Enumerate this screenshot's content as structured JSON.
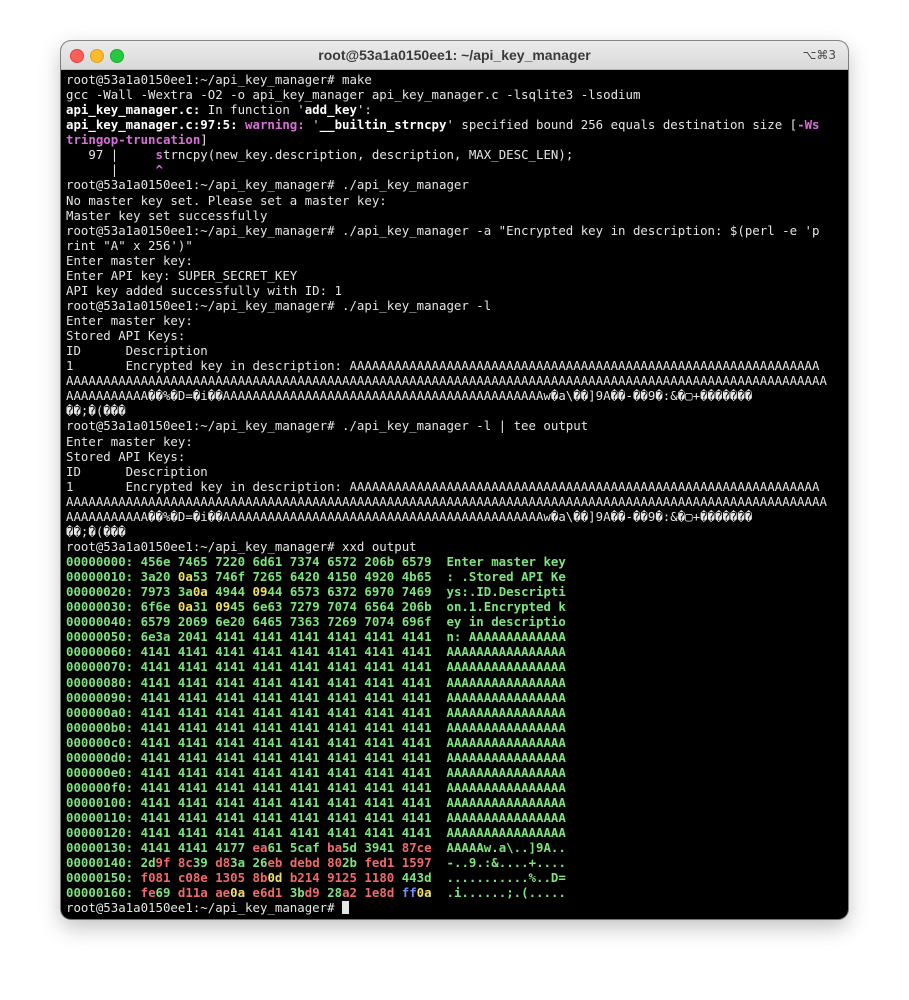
{
  "window": {
    "title": "root@53a1a0150ee1: ~/api_key_manager",
    "shortcut": "⌥⌘3"
  },
  "colors": {
    "green": "#7ee37e",
    "yellow": "#f0e060",
    "red": "#ef6a6a",
    "blue": "#6c8ef5",
    "magenta": "#d670d6"
  },
  "terminal": {
    "prompt": "root@53a1a0150ee1:~/api_key_manager# ",
    "lines": [
      [
        {
          "t": "root@53a1a0150ee1:~/api_key_manager# make"
        }
      ],
      [
        {
          "t": "gcc -Wall -Wextra -O2 -o api_key_manager api_key_manager.c -lsqlite3 -lsodium"
        }
      ],
      [
        {
          "t": "api_key_manager.c:",
          "c": "bold"
        },
        {
          "t": " In function '"
        },
        {
          "t": "add_key",
          "c": "bold"
        },
        {
          "t": "':"
        }
      ],
      [
        {
          "t": "api_key_manager.c:97:5: ",
          "c": "bold"
        },
        {
          "t": "warning: ",
          "c": "mag"
        },
        {
          "t": "'"
        },
        {
          "t": "__builtin_strncpy",
          "c": "bold"
        },
        {
          "t": "' specified bound 256 equals destination size ["
        },
        {
          "t": "-Ws",
          "c": "mag"
        }
      ],
      [
        {
          "t": "tringop-truncation",
          "c": "mag"
        },
        {
          "t": "]"
        }
      ],
      [
        {
          "t": "   97 |     "
        },
        {
          "t": "s",
          "c": "mag"
        },
        {
          "t": "trncpy(new_key.description, description, MAX_DESC_LEN);"
        }
      ],
      [
        {
          "t": "      |     "
        },
        {
          "t": "^",
          "c": "mag"
        }
      ],
      [
        {
          "t": "root@53a1a0150ee1:~/api_key_manager# ./api_key_manager"
        }
      ],
      [
        {
          "t": "No master key set. Please set a master key:"
        }
      ],
      [
        {
          "t": "Master key set successfully"
        }
      ],
      [
        {
          "t": "root@53a1a0150ee1:~/api_key_manager# ./api_key_manager -a \"Encrypted key in description: $(perl -e 'p"
        }
      ],
      [
        {
          "t": "rint \"A\" x 256')\""
        }
      ],
      [
        {
          "t": "Enter master key:"
        }
      ],
      [
        {
          "t": "Enter API key: SUPER_SECRET_KEY"
        }
      ],
      [
        {
          "t": "API key added successfully with ID: 1"
        }
      ],
      [
        {
          "t": "root@53a1a0150ee1:~/api_key_manager# ./api_key_manager -l"
        }
      ],
      [
        {
          "t": "Enter master key:"
        }
      ],
      [
        {
          "t": "Stored API Keys:"
        }
      ],
      [
        {
          "t": "ID      Description"
        }
      ],
      [
        {
          "t": "1       Encrypted key in description: AAAAAAAAAAAAAAAAAAAAAAAAAAAAAAAAAAAAAAAAAAAAAAAAAAAAAAAAAAAAAAA"
        }
      ],
      [
        {
          "t": "AAAAAAAAAAAAAAAAAAAAAAAAAAAAAAAAAAAAAAAAAAAAAAAAAAAAAAAAAAAAAAAAAAAAAAAAAAAAAAAAAAAAAAAAAAAAAAAAAAAAAA"
        }
      ],
      [
        {
          "t": "AAAAAAAAAAA��%�D=�i��AAAAAAAAAAAAAAAAAAAAAAAAAAAAAAAAAAAAAAAAAAAw�a\\��]9A��-��9�:&�▢+�������"
        }
      ],
      [
        {
          "t": "��;�(���"
        }
      ],
      [
        {
          "t": "root@53a1a0150ee1:~/api_key_manager# ./api_key_manager -l | tee output"
        }
      ],
      [
        {
          "t": "Enter master key:"
        }
      ],
      [
        {
          "t": "Stored API Keys:"
        }
      ],
      [
        {
          "t": "ID      Description"
        }
      ],
      [
        {
          "t": "1       Encrypted key in description: AAAAAAAAAAAAAAAAAAAAAAAAAAAAAAAAAAAAAAAAAAAAAAAAAAAAAAAAAAAAAAA"
        }
      ],
      [
        {
          "t": "AAAAAAAAAAAAAAAAAAAAAAAAAAAAAAAAAAAAAAAAAAAAAAAAAAAAAAAAAAAAAAAAAAAAAAAAAAAAAAAAAAAAAAAAAAAAAAAAAAAAAA"
        }
      ],
      [
        {
          "t": "AAAAAAAAAAA��%�D=�i��AAAAAAAAAAAAAAAAAAAAAAAAAAAAAAAAAAAAAAAAAAAw�a\\��]9A��-��9�:&�▢+�������"
        }
      ],
      [
        {
          "t": "��;�(���"
        }
      ],
      [
        {
          "t": "root@53a1a0150ee1:~/api_key_manager# xxd output"
        }
      ],
      [
        {
          "t": "00000000: ",
          "c": "grn"
        },
        {
          "t": "456e 7465 7220 6d61 7374 6572 206b 6579",
          "c": "grn"
        },
        {
          "t": "  "
        },
        {
          "t": "Enter master key",
          "c": "grn"
        }
      ],
      [
        {
          "t": "00000010: ",
          "c": "grn"
        },
        {
          "t": "3a20 ",
          "c": "grn"
        },
        {
          "t": "0a",
          "c": "yel"
        },
        {
          "t": "53 746f 7265 6420 4150 4920 4b65",
          "c": "grn"
        },
        {
          "t": "  "
        },
        {
          "t": ": .Stored API Ke",
          "c": "grn"
        }
      ],
      [
        {
          "t": "00000020: ",
          "c": "grn"
        },
        {
          "t": "7973 3a",
          "c": "grn"
        },
        {
          "t": "0a",
          "c": "yel"
        },
        {
          "t": " 4944 ",
          "c": "grn"
        },
        {
          "t": "09",
          "c": "yel"
        },
        {
          "t": "44 6573 6372 6970 7469",
          "c": "grn"
        },
        {
          "t": "  "
        },
        {
          "t": "ys:.ID.Descripti",
          "c": "grn"
        }
      ],
      [
        {
          "t": "00000030: ",
          "c": "grn"
        },
        {
          "t": "6f6e ",
          "c": "grn"
        },
        {
          "t": "0a",
          "c": "yel"
        },
        {
          "t": "31 ",
          "c": "grn"
        },
        {
          "t": "09",
          "c": "yel"
        },
        {
          "t": "45 6e63 7279 7074 6564 206b",
          "c": "grn"
        },
        {
          "t": "  "
        },
        {
          "t": "on.1.Encrypted k",
          "c": "grn"
        }
      ],
      [
        {
          "t": "00000040: ",
          "c": "grn"
        },
        {
          "t": "6579 2069 6e20 6465 7363 7269 7074 696f",
          "c": "grn"
        },
        {
          "t": "  "
        },
        {
          "t": "ey in descriptio",
          "c": "grn"
        }
      ],
      [
        {
          "t": "00000050: ",
          "c": "grn"
        },
        {
          "t": "6e3a 2041 4141 4141 4141 4141 4141 4141",
          "c": "grn"
        },
        {
          "t": "  "
        },
        {
          "t": "n: AAAAAAAAAAAAA",
          "c": "grn"
        }
      ],
      [
        {
          "t": "00000060: ",
          "c": "grn"
        },
        {
          "t": "4141 4141 4141 4141 4141 4141 4141 4141",
          "c": "grn"
        },
        {
          "t": "  "
        },
        {
          "t": "AAAAAAAAAAAAAAAA",
          "c": "grn"
        }
      ],
      [
        {
          "t": "00000070: ",
          "c": "grn"
        },
        {
          "t": "4141 4141 4141 4141 4141 4141 4141 4141",
          "c": "grn"
        },
        {
          "t": "  "
        },
        {
          "t": "AAAAAAAAAAAAAAAA",
          "c": "grn"
        }
      ],
      [
        {
          "t": "00000080: ",
          "c": "grn"
        },
        {
          "t": "4141 4141 4141 4141 4141 4141 4141 4141",
          "c": "grn"
        },
        {
          "t": "  "
        },
        {
          "t": "AAAAAAAAAAAAAAAA",
          "c": "grn"
        }
      ],
      [
        {
          "t": "00000090: ",
          "c": "grn"
        },
        {
          "t": "4141 4141 4141 4141 4141 4141 4141 4141",
          "c": "grn"
        },
        {
          "t": "  "
        },
        {
          "t": "AAAAAAAAAAAAAAAA",
          "c": "grn"
        }
      ],
      [
        {
          "t": "000000a0: ",
          "c": "grn"
        },
        {
          "t": "4141 4141 4141 4141 4141 4141 4141 4141",
          "c": "grn"
        },
        {
          "t": "  "
        },
        {
          "t": "AAAAAAAAAAAAAAAA",
          "c": "grn"
        }
      ],
      [
        {
          "t": "000000b0: ",
          "c": "grn"
        },
        {
          "t": "4141 4141 4141 4141 4141 4141 4141 4141",
          "c": "grn"
        },
        {
          "t": "  "
        },
        {
          "t": "AAAAAAAAAAAAAAAA",
          "c": "grn"
        }
      ],
      [
        {
          "t": "000000c0: ",
          "c": "grn"
        },
        {
          "t": "4141 4141 4141 4141 4141 4141 4141 4141",
          "c": "grn"
        },
        {
          "t": "  "
        },
        {
          "t": "AAAAAAAAAAAAAAAA",
          "c": "grn"
        }
      ],
      [
        {
          "t": "000000d0: ",
          "c": "grn"
        },
        {
          "t": "4141 4141 4141 4141 4141 4141 4141 4141",
          "c": "grn"
        },
        {
          "t": "  "
        },
        {
          "t": "AAAAAAAAAAAAAAAA",
          "c": "grn"
        }
      ],
      [
        {
          "t": "000000e0: ",
          "c": "grn"
        },
        {
          "t": "4141 4141 4141 4141 4141 4141 4141 4141",
          "c": "grn"
        },
        {
          "t": "  "
        },
        {
          "t": "AAAAAAAAAAAAAAAA",
          "c": "grn"
        }
      ],
      [
        {
          "t": "000000f0: ",
          "c": "grn"
        },
        {
          "t": "4141 4141 4141 4141 4141 4141 4141 4141",
          "c": "grn"
        },
        {
          "t": "  "
        },
        {
          "t": "AAAAAAAAAAAAAAAA",
          "c": "grn"
        }
      ],
      [
        {
          "t": "00000100: ",
          "c": "grn"
        },
        {
          "t": "4141 4141 4141 4141 4141 4141 4141 4141",
          "c": "grn"
        },
        {
          "t": "  "
        },
        {
          "t": "AAAAAAAAAAAAAAAA",
          "c": "grn"
        }
      ],
      [
        {
          "t": "00000110: ",
          "c": "grn"
        },
        {
          "t": "4141 4141 4141 4141 4141 4141 4141 4141",
          "c": "grn"
        },
        {
          "t": "  "
        },
        {
          "t": "AAAAAAAAAAAAAAAA",
          "c": "grn"
        }
      ],
      [
        {
          "t": "00000120: ",
          "c": "grn"
        },
        {
          "t": "4141 4141 4141 4141 4141 4141 4141 4141",
          "c": "grn"
        },
        {
          "t": "  "
        },
        {
          "t": "AAAAAAAAAAAAAAAA",
          "c": "grn"
        }
      ],
      [
        {
          "t": "00000130: ",
          "c": "grn"
        },
        {
          "t": "4141 4141 4177 ",
          "c": "grn"
        },
        {
          "t": "ea",
          "c": "red"
        },
        {
          "t": "61 5caf ",
          "c": "grn"
        },
        {
          "t": "ba",
          "c": "red"
        },
        {
          "t": "5d 3941 ",
          "c": "grn"
        },
        {
          "t": "87ce",
          "c": "red"
        },
        {
          "t": "  "
        },
        {
          "t": "AAAAAw.a\\..]9A..",
          "c": "grn"
        }
      ],
      [
        {
          "t": "00000140: ",
          "c": "grn"
        },
        {
          "t": "2d",
          "c": "grn"
        },
        {
          "t": "9f ",
          "c": "red"
        },
        {
          "t": "8c",
          "c": "red"
        },
        {
          "t": "39 ",
          "c": "grn"
        },
        {
          "t": "d8",
          "c": "red"
        },
        {
          "t": "3a ",
          "c": "grn"
        },
        {
          "t": "26",
          "c": "grn"
        },
        {
          "t": "eb debd ",
          "c": "red"
        },
        {
          "t": "80",
          "c": "red"
        },
        {
          "t": "2b ",
          "c": "grn"
        },
        {
          "t": "fed1 ",
          "c": "red"
        },
        {
          "t": "1597",
          "c": "red"
        },
        {
          "t": "  "
        },
        {
          "t": "-..9.:&....+....",
          "c": "grn"
        }
      ],
      [
        {
          "t": "00000150: ",
          "c": "grn"
        },
        {
          "t": "f081 c08e 1305 8b",
          "c": "red"
        },
        {
          "t": "0d",
          "c": "yel"
        },
        {
          "t": " b214 9125 1180 ",
          "c": "red"
        },
        {
          "t": "443d",
          "c": "grn"
        },
        {
          "t": "  "
        },
        {
          "t": "...........%..D=",
          "c": "grn"
        }
      ],
      [
        {
          "t": "00000160: ",
          "c": "grn"
        },
        {
          "t": "fe",
          "c": "red"
        },
        {
          "t": "69 ",
          "c": "grn"
        },
        {
          "t": "d11a ae",
          "c": "red"
        },
        {
          "t": "0a",
          "c": "yel"
        },
        {
          "t": " e6d1 ",
          "c": "red"
        },
        {
          "t": "3b",
          "c": "grn"
        },
        {
          "t": "d9 ",
          "c": "red"
        },
        {
          "t": "28",
          "c": "grn"
        },
        {
          "t": "a2 1e8d ",
          "c": "red"
        },
        {
          "t": "ff",
          "c": "blu"
        },
        {
          "t": "0a",
          "c": "yel"
        },
        {
          "t": "  "
        },
        {
          "t": ".i......;.(.....",
          "c": "grn"
        }
      ]
    ]
  }
}
